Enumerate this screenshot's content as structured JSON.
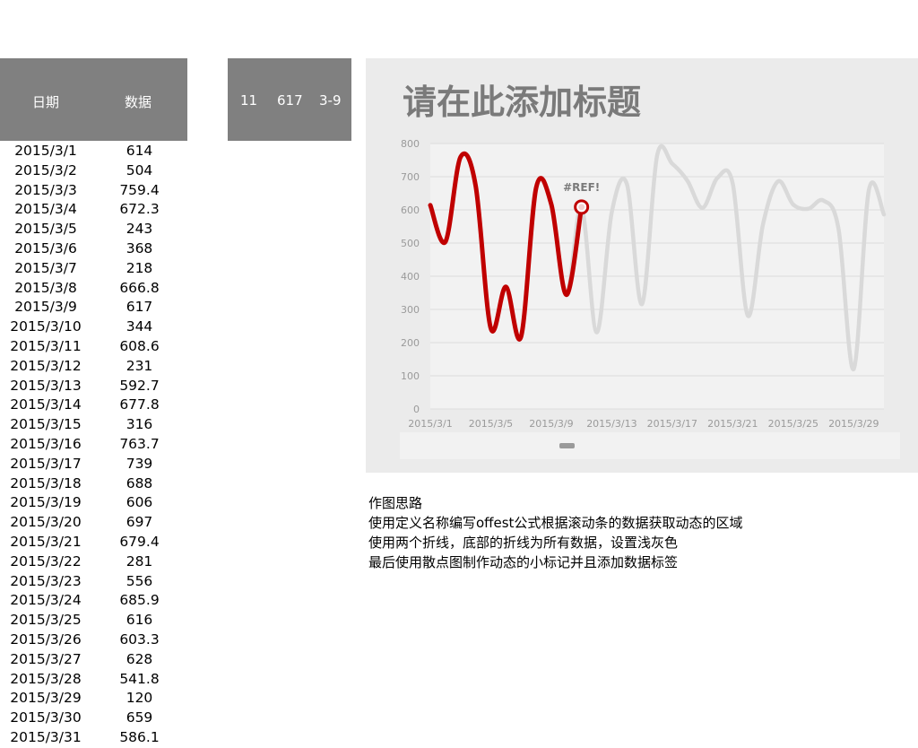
{
  "table": {
    "header": {
      "date": "日期",
      "value": "数据"
    },
    "rows": [
      {
        "date": "2015/3/1",
        "value": "614"
      },
      {
        "date": "2015/3/2",
        "value": "504"
      },
      {
        "date": "2015/3/3",
        "value": "759.4"
      },
      {
        "date": "2015/3/4",
        "value": "672.3"
      },
      {
        "date": "2015/3/5",
        "value": "243"
      },
      {
        "date": "2015/3/6",
        "value": "368"
      },
      {
        "date": "2015/3/7",
        "value": "218"
      },
      {
        "date": "2015/3/8",
        "value": "666.8"
      },
      {
        "date": "2015/3/9",
        "value": "617"
      },
      {
        "date": "2015/3/10",
        "value": "344"
      },
      {
        "date": "2015/3/11",
        "value": "608.6"
      },
      {
        "date": "2015/3/12",
        "value": "231"
      },
      {
        "date": "2015/3/13",
        "value": "592.7"
      },
      {
        "date": "2015/3/14",
        "value": "677.8"
      },
      {
        "date": "2015/3/15",
        "value": "316"
      },
      {
        "date": "2015/3/16",
        "value": "763.7"
      },
      {
        "date": "2015/3/17",
        "value": "739"
      },
      {
        "date": "2015/3/18",
        "value": "688"
      },
      {
        "date": "2015/3/19",
        "value": "606"
      },
      {
        "date": "2015/3/20",
        "value": "697"
      },
      {
        "date": "2015/3/21",
        "value": "679.4"
      },
      {
        "date": "2015/3/22",
        "value": "281"
      },
      {
        "date": "2015/3/23",
        "value": "556"
      },
      {
        "date": "2015/3/24",
        "value": "685.9"
      },
      {
        "date": "2015/3/25",
        "value": "616"
      },
      {
        "date": "2015/3/26",
        "value": "603.3"
      },
      {
        "date": "2015/3/27",
        "value": "628"
      },
      {
        "date": "2015/3/28",
        "value": "541.8"
      },
      {
        "date": "2015/3/29",
        "value": "120"
      },
      {
        "date": "2015/3/30",
        "value": "659"
      },
      {
        "date": "2015/3/31",
        "value": "586.1"
      }
    ]
  },
  "control_cells": {
    "index": "11",
    "value": "617",
    "range": "3-9"
  },
  "notes": {
    "title": "作图思路",
    "lines": [
      "使用定义名称编写offest公式根据滚动条的数据获取动态的区域",
      "使用两个折线，底部的折线为所有数据，设置浅灰色",
      "最后使用散点图制作动态的小标记并且添加数据标签"
    ]
  },
  "chart_data": {
    "type": "line",
    "title": "请在此添加标题",
    "x": [
      "2015/3/1",
      "2015/3/2",
      "2015/3/3",
      "2015/3/4",
      "2015/3/5",
      "2015/3/6",
      "2015/3/7",
      "2015/3/8",
      "2015/3/9",
      "2015/3/10",
      "2015/3/11",
      "2015/3/12",
      "2015/3/13",
      "2015/3/14",
      "2015/3/15",
      "2015/3/16",
      "2015/3/17",
      "2015/3/18",
      "2015/3/19",
      "2015/3/20",
      "2015/3/21",
      "2015/3/22",
      "2015/3/23",
      "2015/3/24",
      "2015/3/25",
      "2015/3/26",
      "2015/3/27",
      "2015/3/28",
      "2015/3/29",
      "2015/3/30",
      "2015/3/31"
    ],
    "x_tick_labels": [
      "2015/3/1",
      "2015/3/5",
      "2015/3/9",
      "2015/3/13",
      "2015/3/17",
      "2015/3/21",
      "2015/3/25",
      "2015/3/29"
    ],
    "series": [
      {
        "role": "all-data",
        "color": "#d9d9d9",
        "values": [
          614,
          504,
          759.4,
          672.3,
          243,
          368,
          218,
          666.8,
          617,
          344,
          608.6,
          231,
          592.7,
          677.8,
          316,
          763.7,
          739,
          688,
          606,
          697,
          679.4,
          281,
          556,
          685.9,
          616,
          603.3,
          628,
          541.8,
          120,
          659,
          586.1
        ]
      },
      {
        "role": "dynamic-window",
        "color": "#c00000",
        "values": [
          614,
          504,
          759.4,
          672.3,
          243,
          368,
          218,
          666.8,
          617,
          344,
          608.6
        ]
      }
    ],
    "marker": {
      "x": "2015/3/11",
      "y": 608.6,
      "label": "#REF!",
      "color": "#c00000"
    },
    "ylim": [
      0,
      800
    ],
    "y_ticks": [
      0,
      100,
      200,
      300,
      400,
      500,
      600,
      700,
      800
    ],
    "grid": true,
    "scrollbar": true
  }
}
